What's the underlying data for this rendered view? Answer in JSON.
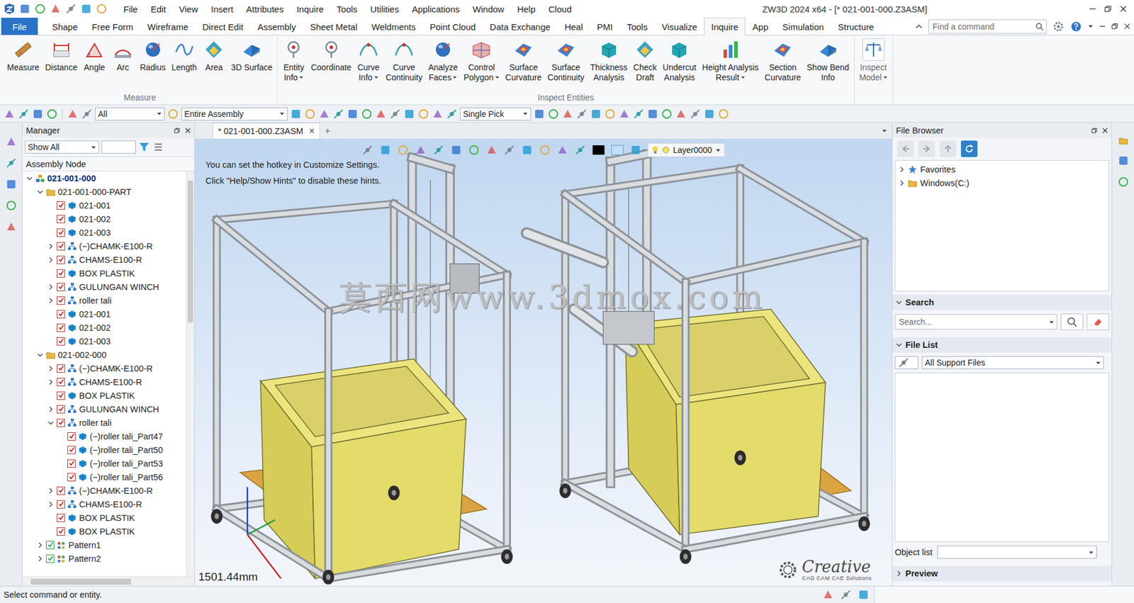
{
  "window": {
    "title": "ZW3D 2024 x64 - [* 021-001-000.Z3ASM]"
  },
  "menu": [
    "File",
    "Edit",
    "View",
    "Insert",
    "Attributes",
    "Inquire",
    "Tools",
    "Utilities",
    "Applications",
    "Window",
    "Help",
    "Cloud"
  ],
  "ribbon_tabs": [
    {
      "label": "File",
      "kind": "file",
      "selected": false
    },
    {
      "label": "Shape",
      "kind": "tab",
      "selected": false
    },
    {
      "label": "Free Form",
      "kind": "tab",
      "selected": false
    },
    {
      "label": "Wireframe",
      "kind": "tab",
      "selected": false
    },
    {
      "label": "Direct Edit",
      "kind": "tab",
      "selected": false
    },
    {
      "label": "Assembly",
      "kind": "tab",
      "selected": false
    },
    {
      "label": "Sheet Metal",
      "kind": "tab",
      "selected": false
    },
    {
      "label": "Weldments",
      "kind": "tab",
      "selected": false
    },
    {
      "label": "Point Cloud",
      "kind": "tab",
      "selected": false
    },
    {
      "label": "Data Exchange",
      "kind": "tab",
      "selected": false
    },
    {
      "label": "Heal",
      "kind": "tab",
      "selected": false
    },
    {
      "label": "PMI",
      "kind": "tab",
      "selected": false
    },
    {
      "label": "Tools",
      "kind": "tab",
      "selected": false
    },
    {
      "label": "Visualize",
      "kind": "tab",
      "selected": false
    },
    {
      "label": "Inquire",
      "kind": "tab",
      "selected": true
    },
    {
      "label": "App",
      "kind": "tab",
      "selected": false
    },
    {
      "label": "Simulation",
      "kind": "tab",
      "selected": false
    },
    {
      "label": "Structure",
      "kind": "tab",
      "selected": false
    }
  ],
  "command_search": {
    "placeholder": "Find a command"
  },
  "ribbon_groups": [
    {
      "title": "Measure",
      "collapsed": false,
      "buttons": [
        {
          "lines": [
            "Measure"
          ],
          "dropdown": false
        },
        {
          "lines": [
            "Distance"
          ],
          "dropdown": false
        },
        {
          "lines": [
            "Angle"
          ],
          "dropdown": false
        },
        {
          "lines": [
            "Arc"
          ],
          "dropdown": false
        },
        {
          "lines": [
            "Radius"
          ],
          "dropdown": false
        },
        {
          "lines": [
            "Length"
          ],
          "dropdown": false
        },
        {
          "lines": [
            "Area"
          ],
          "dropdown": false
        },
        {
          "lines": [
            "3D Surface"
          ],
          "dropdown": false
        }
      ]
    },
    {
      "title": "Inspect Entities",
      "collapsed": false,
      "buttons": [
        {
          "lines": [
            "Entity",
            "Info"
          ],
          "dropdown": true
        },
        {
          "lines": [
            "Coordinate"
          ],
          "dropdown": false
        },
        {
          "lines": [
            "Curve",
            "Info"
          ],
          "dropdown": true
        },
        {
          "lines": [
            "Curve",
            "Continuity"
          ],
          "dropdown": false
        },
        {
          "lines": [
            "Analyze",
            "Faces"
          ],
          "dropdown": true
        },
        {
          "lines": [
            "Control",
            "Polygon"
          ],
          "dropdown": true
        },
        {
          "lines": [
            "Surface",
            "Curvature"
          ],
          "dropdown": false
        },
        {
          "lines": [
            "Surface",
            "Continuity"
          ],
          "dropdown": false
        },
        {
          "lines": [
            "Thickness",
            "Analysis"
          ],
          "dropdown": false
        },
        {
          "lines": [
            "Check",
            "Draft"
          ],
          "dropdown": false
        },
        {
          "lines": [
            "Undercut",
            "Analysis"
          ],
          "dropdown": false
        },
        {
          "lines": [
            "Height Analysis",
            "Result"
          ],
          "dropdown": true
        },
        {
          "lines": [
            "Section",
            "Curvature"
          ],
          "dropdown": false
        },
        {
          "lines": [
            "Show Bend",
            "Info"
          ],
          "dropdown": false
        }
      ]
    },
    {
      "collapsed": true,
      "buttons": [
        {
          "lines": [
            "Inspect",
            "Model"
          ],
          "dropdown": true
        }
      ]
    }
  ],
  "toolbar": {
    "filter": "All",
    "scope": "Entire Assembly",
    "pick": "Single Pick"
  },
  "manager": {
    "title": "Manager",
    "filter": "Show All",
    "column": "Assembly Node",
    "tree": [
      {
        "label": "021-001-000",
        "depth": 0,
        "kind": "root",
        "checked": false,
        "has_children": true,
        "expanded": true
      },
      {
        "label": "021-001-000-PART",
        "depth": 1,
        "kind": "folder",
        "checked": false,
        "has_children": true,
        "expanded": true
      },
      {
        "label": "021-001",
        "depth": 2,
        "kind": "part",
        "checked": true,
        "has_children": false,
        "expanded": false
      },
      {
        "label": "021-002",
        "depth": 2,
        "kind": "part",
        "checked": true,
        "has_children": false,
        "expanded": false
      },
      {
        "label": "021-003",
        "depth": 2,
        "kind": "part",
        "checked": true,
        "has_children": false,
        "expanded": false
      },
      {
        "label": "(−)CHAMK-E100-R",
        "depth": 2,
        "kind": "subassembly",
        "checked": true,
        "has_children": true,
        "expanded": false
      },
      {
        "label": "CHAMS-E100-R",
        "depth": 2,
        "kind": "subassembly",
        "checked": true,
        "has_children": true,
        "expanded": false
      },
      {
        "label": "BOX PLASTIK",
        "depth": 2,
        "kind": "part",
        "checked": true,
        "has_children": false,
        "expanded": false
      },
      {
        "label": "GULUNGAN WINCH",
        "depth": 2,
        "kind": "subassembly",
        "checked": true,
        "has_children": true,
        "expanded": false
      },
      {
        "label": "roller tali",
        "depth": 2,
        "kind": "subassembly",
        "checked": true,
        "has_children": true,
        "expanded": false
      },
      {
        "label": "021-001",
        "depth": 2,
        "kind": "part",
        "checked": true,
        "has_children": false,
        "expanded": false
      },
      {
        "label": "021-002",
        "depth": 2,
        "kind": "part",
        "checked": true,
        "has_children": false,
        "expanded": false
      },
      {
        "label": "021-003",
        "depth": 2,
        "kind": "part",
        "checked": true,
        "has_children": false,
        "expanded": false
      },
      {
        "label": "021-002-000",
        "depth": 1,
        "kind": "folder",
        "checked": false,
        "has_children": true,
        "expanded": true
      },
      {
        "label": "(−)CHAMK-E100-R",
        "depth": 2,
        "kind": "subassembly",
        "checked": true,
        "has_children": true,
        "expanded": false
      },
      {
        "label": "CHAMS-E100-R",
        "depth": 2,
        "kind": "subassembly",
        "checked": true,
        "has_children": true,
        "expanded": false
      },
      {
        "label": "BOX PLASTIK",
        "depth": 2,
        "kind": "part",
        "checked": true,
        "has_children": false,
        "expanded": false
      },
      {
        "label": "GULUNGAN WINCH",
        "depth": 2,
        "kind": "subassembly",
        "checked": true,
        "has_children": true,
        "expanded": false
      },
      {
        "label": "roller tali",
        "depth": 2,
        "kind": "subassembly",
        "checked": true,
        "has_children": true,
        "expanded": true
      },
      {
        "label": "(−)roller tali_Part47",
        "depth": 3,
        "kind": "part",
        "checked": true,
        "has_children": false,
        "expanded": false
      },
      {
        "label": "(−)roller tali_Part50",
        "depth": 3,
        "kind": "part",
        "checked": true,
        "has_children": false,
        "expanded": false
      },
      {
        "label": "(−)roller tali_Part53",
        "depth": 3,
        "kind": "part",
        "checked": true,
        "has_children": false,
        "expanded": false
      },
      {
        "label": "(−)roller tali_Part56",
        "depth": 3,
        "kind": "part",
        "checked": true,
        "has_children": false,
        "expanded": false
      },
      {
        "label": "(−)CHAMK-E100-R",
        "depth": 2,
        "kind": "subassembly",
        "checked": true,
        "has_children": true,
        "expanded": false
      },
      {
        "label": "CHAMS-E100-R",
        "depth": 2,
        "kind": "subassembly",
        "checked": true,
        "has_children": true,
        "expanded": false
      },
      {
        "label": "BOX PLASTIK",
        "depth": 2,
        "kind": "part",
        "checked": true,
        "has_children": false,
        "expanded": false
      },
      {
        "label": "BOX PLASTIK",
        "depth": 2,
        "kind": "part",
        "checked": true,
        "has_children": false,
        "expanded": false
      },
      {
        "label": "Pattern1",
        "depth": 1,
        "kind": "pattern",
        "checked": true,
        "has_children": true,
        "expanded": false
      },
      {
        "label": "Pattern2",
        "depth": 1,
        "kind": "pattern",
        "checked": true,
        "has_children": true,
        "expanded": false
      }
    ]
  },
  "document_tab": {
    "label": "* 021-001-000.Z3ASM",
    "close": "×",
    "add": "+"
  },
  "viewport": {
    "hints": [
      "You can set the hotkey in Customize Settings.",
      "Click \"Help/Show Hints\" to disable these hints."
    ],
    "layer": "Layer0000",
    "scale": "1501.44mm",
    "watermark": "莫西网www.3dmox.com",
    "logo": {
      "name": "Creative",
      "tagline": "CAD CAM CAE Solutions"
    }
  },
  "file_browser": {
    "title": "File Browser",
    "tree": [
      {
        "label": "Favorites",
        "kind": "favorites",
        "expanded": false
      },
      {
        "label": "Windows(C:)",
        "kind": "drive",
        "expanded": false
      }
    ],
    "search_title": "Search",
    "search_expanded": true,
    "search_placeholder": "Search...",
    "file_list_title": "File List",
    "file_list_expanded": true,
    "file_filter": "All Support Files",
    "object_list_label": "Object list",
    "preview_title": "Preview",
    "preview_expanded": false
  },
  "status_bar": {
    "text": "Select command or entity."
  }
}
